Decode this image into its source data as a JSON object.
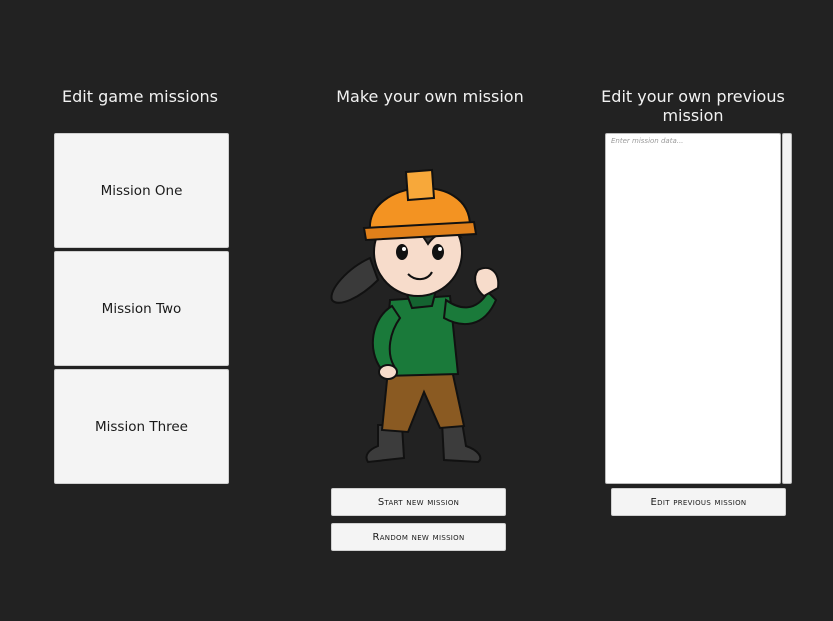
{
  "left_panel": {
    "title": "Edit game missions",
    "missions": [
      {
        "label": "Mission One"
      },
      {
        "label": "Mission Two"
      },
      {
        "label": "Mission Three"
      }
    ]
  },
  "center_panel": {
    "title": "Make your own mission",
    "character": "construction-worker-girl-illustration",
    "start_label": "Start new mission",
    "random_label": "Random new mission"
  },
  "right_panel": {
    "title": "Edit your own previous mission",
    "textarea_placeholder": "Enter mission data...",
    "textarea_value": "",
    "edit_label": "Edit previous mission"
  },
  "colors": {
    "background": "#222222",
    "button_bg": "#f4f4f4",
    "text_light": "#f2f2f2",
    "helmet": "#f39322",
    "sweater": "#1a7a3a",
    "pants": "#8a5a22"
  }
}
